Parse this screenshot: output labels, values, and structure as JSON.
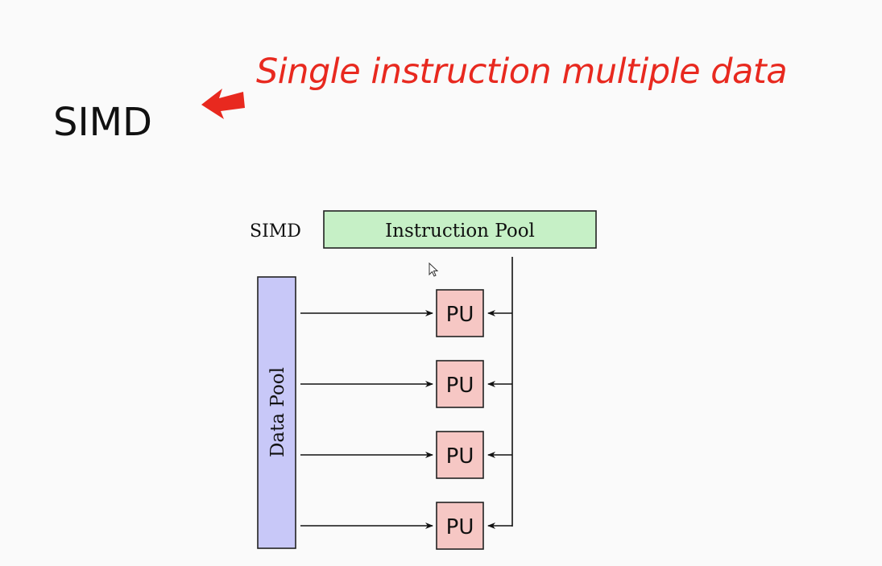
{
  "slide": {
    "title": "SIMD",
    "annotation": "Single instruction multiple data"
  },
  "diagram": {
    "side_label": "SIMD",
    "instruction_pool_label": "Instruction Pool",
    "data_pool_label": "Data Pool",
    "processing_units": [
      "PU",
      "PU",
      "PU",
      "PU"
    ],
    "colors": {
      "instruction_pool_fill": "#c6f0c6",
      "data_pool_fill": "#c8c8f8",
      "pu_fill": "#f6c7c4",
      "annotation": "#e8291f"
    }
  }
}
